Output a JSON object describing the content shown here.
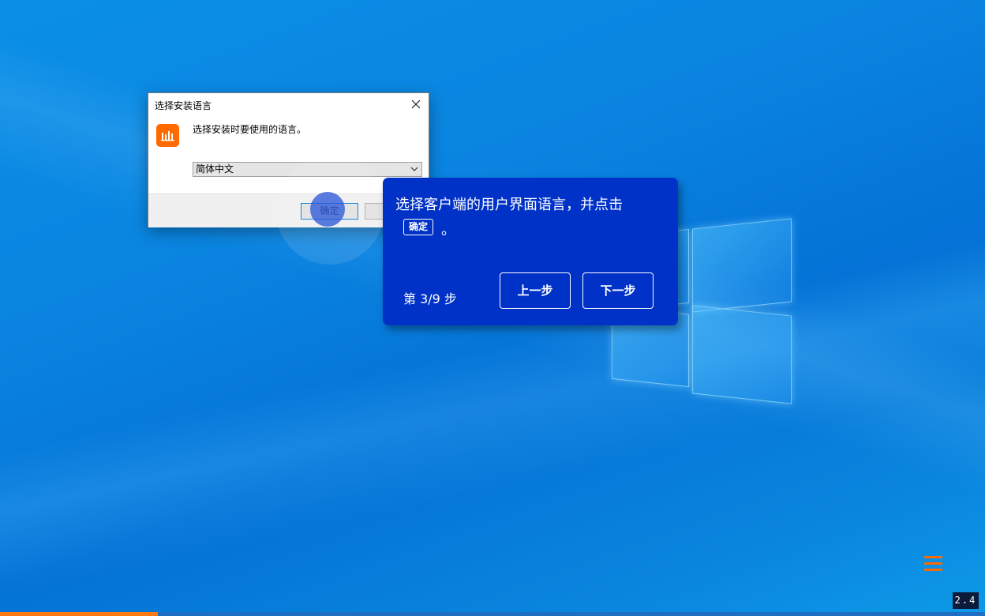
{
  "dialog": {
    "title": "选择安装语言",
    "prompt": "选择安装时要使用的语言。",
    "selected_language": "简体中文",
    "ok_label": "确定",
    "cancel_label": ""
  },
  "tip": {
    "text": "选择客户端的用户界面语言，并点击",
    "inline_button": "确定",
    "period": "。",
    "step": "第 3/9 步",
    "prev_label": "上一步",
    "next_label": "下一步"
  },
  "version": "2.4",
  "progress": {
    "fraction": 0.16
  },
  "colors": {
    "accent": "#ff6a00",
    "tip_background": "#0032c8"
  },
  "icons": {
    "close": "close-icon",
    "app": "app-logo-icon",
    "dropdown": "chevron-down-icon",
    "menu": "hamburger-menu-icon"
  }
}
